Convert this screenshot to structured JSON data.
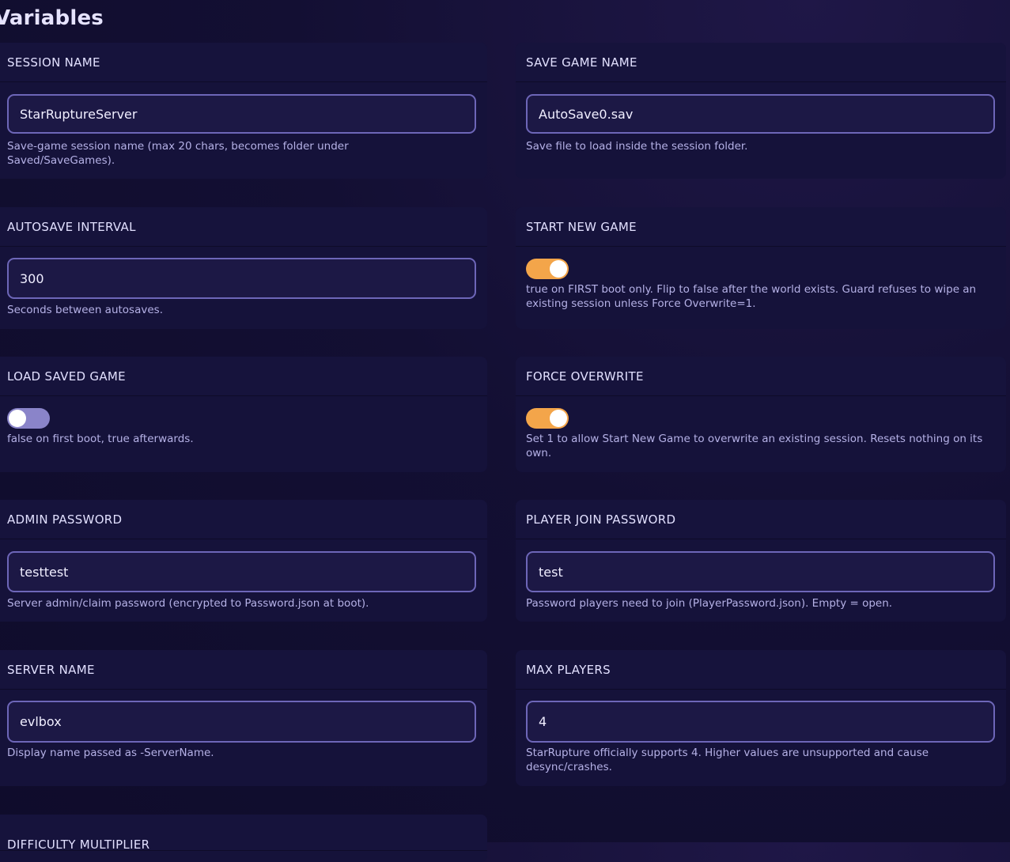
{
  "page": {
    "title": "Variables"
  },
  "colors": {
    "background": "#130f33",
    "card": "#15123a",
    "input_border": "#6d66b8",
    "toggle_on": "#f3a54a",
    "toggle_off": "#8a84c9"
  },
  "fields": {
    "session_name": {
      "label": "SESSION NAME",
      "value": "StarRuptureServer",
      "help": "Save-game session name (max 20 chars, becomes folder under Saved/SaveGames)."
    },
    "save_game_name": {
      "label": "SAVE GAME NAME",
      "value": "AutoSave0.sav",
      "help": "Save file to load inside the session folder."
    },
    "autosave_interval": {
      "label": "AUTOSAVE INTERVAL",
      "value": "300",
      "help": "Seconds between autosaves."
    },
    "start_new_game": {
      "label": "START NEW GAME",
      "state": "on",
      "help": "true on FIRST boot only. Flip to false after the world exists. Guard refuses to wipe an existing session unless Force Overwrite=1."
    },
    "load_saved_game": {
      "label": "LOAD SAVED GAME",
      "state": "off",
      "help": "false on first boot, true afterwards."
    },
    "force_overwrite": {
      "label": "FORCE OVERWRITE",
      "state": "on",
      "help": "Set 1 to allow Start New Game to overwrite an existing session. Resets nothing on its own."
    },
    "admin_password": {
      "label": "ADMIN PASSWORD",
      "value": "testtest",
      "help": "Server admin/claim password (encrypted to Password.json at boot)."
    },
    "player_join_password": {
      "label": "PLAYER JOIN PASSWORD",
      "value": "test",
      "help": "Password players need to join (PlayerPassword.json). Empty = open."
    },
    "server_name": {
      "label": "SERVER NAME",
      "value": "evlbox",
      "help": "Display name passed as -ServerName."
    },
    "max_players": {
      "label": "MAX PLAYERS",
      "value": "4",
      "help": "StarRupture officially supports 4. Higher values are unsupported and cause desync/crashes."
    },
    "difficulty_multiplier": {
      "label": "DIFFICULTY MULTIPLIER"
    }
  }
}
